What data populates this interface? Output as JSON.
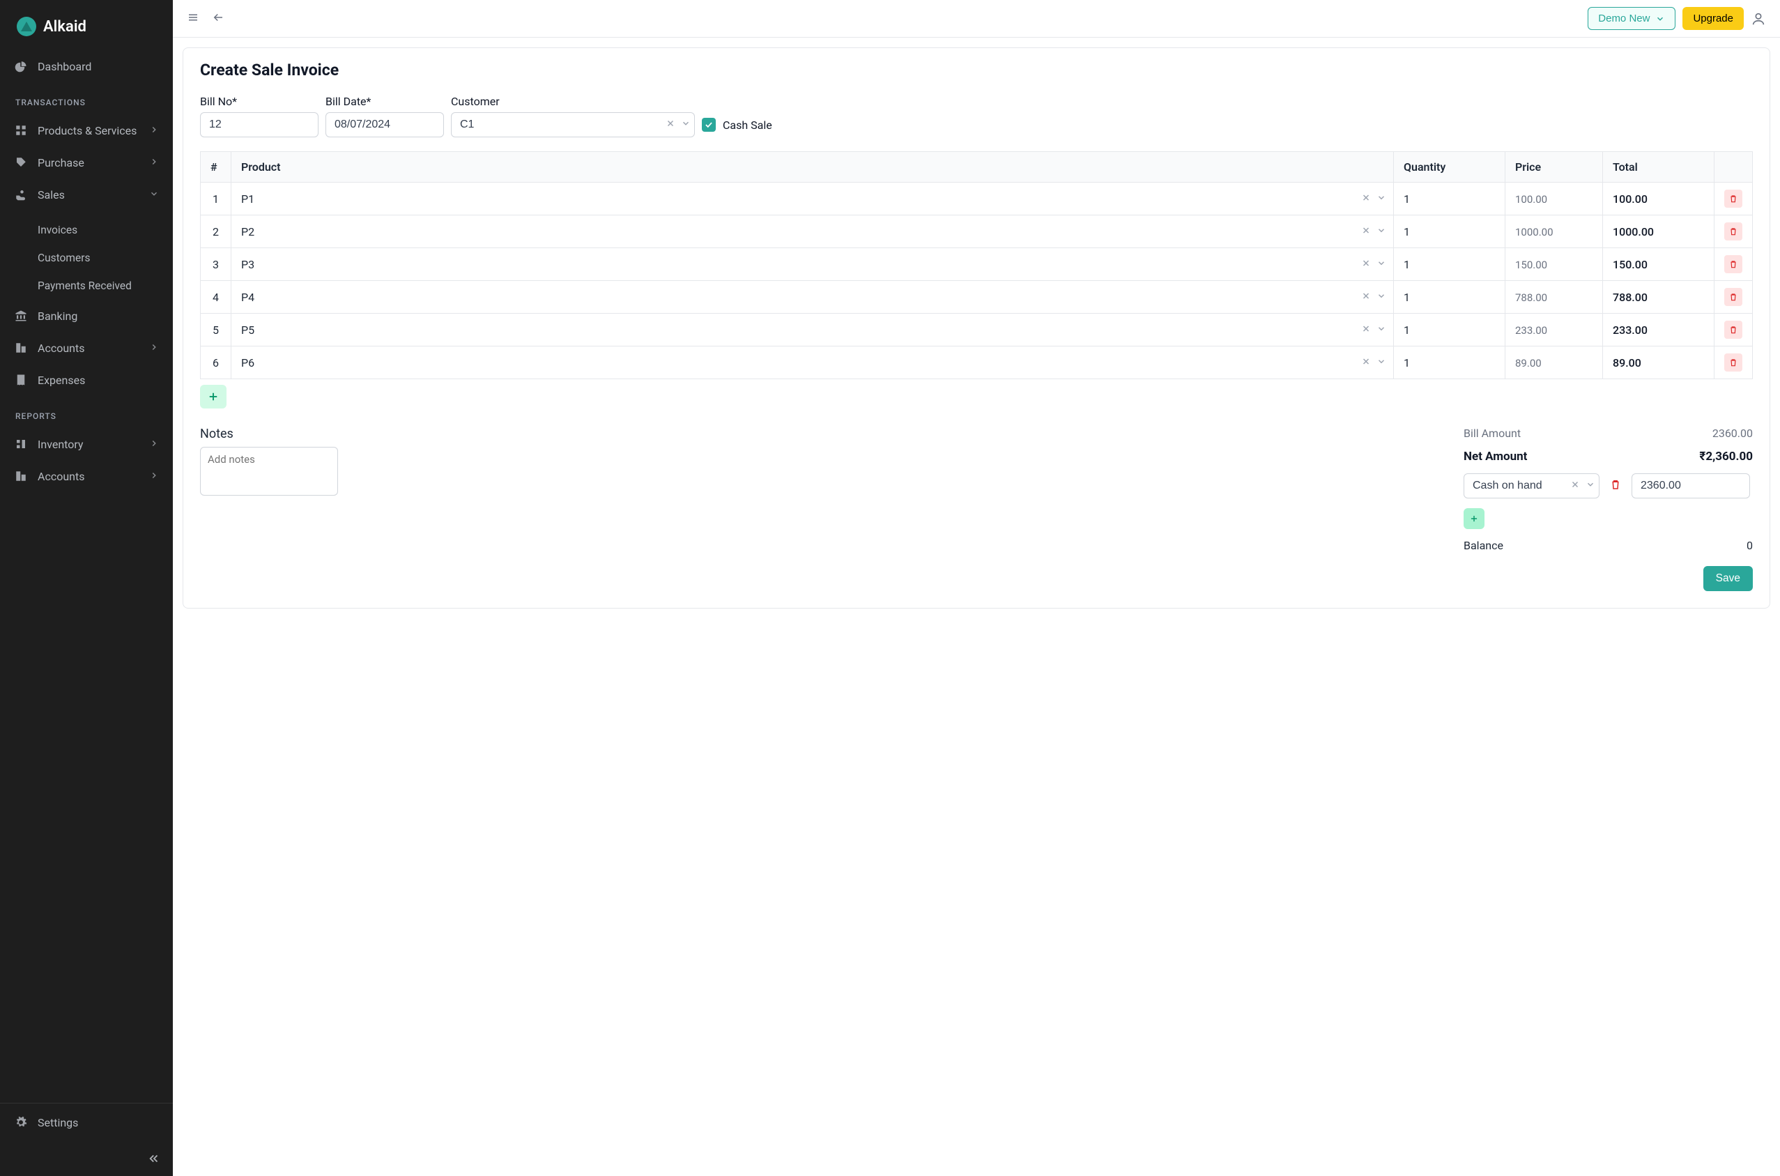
{
  "brand": {
    "name": "Alkaid"
  },
  "sidebar": {
    "dashboard": "Dashboard",
    "sections": {
      "transactions": "TRANSACTIONS",
      "reports": "REPORTS"
    },
    "items": {
      "products": "Products & Services",
      "purchase": "Purchase",
      "sales": "Sales",
      "banking": "Banking",
      "accounts1": "Accounts",
      "expenses": "Expenses",
      "inventory": "Inventory",
      "accounts2": "Accounts",
      "settings": "Settings"
    },
    "sales_sub": {
      "invoices": "Invoices",
      "customers": "Customers",
      "payments": "Payments Received"
    }
  },
  "topbar": {
    "demo": "Demo New",
    "upgrade": "Upgrade"
  },
  "page": {
    "title": "Create Sale Invoice",
    "labels": {
      "bill_no": "Bill No*",
      "bill_date": "Bill Date*",
      "customer": "Customer",
      "cash_sale": "Cash Sale",
      "notes": "Notes",
      "bill_amount": "Bill Amount",
      "net_amount": "Net Amount",
      "balance": "Balance",
      "save": "Save"
    },
    "fields": {
      "bill_no": "12",
      "bill_date": "08/07/2024",
      "customer": "C1",
      "cash_sale_checked": true,
      "notes_placeholder": "Add notes"
    }
  },
  "table": {
    "headers": {
      "idx": "#",
      "product": "Product",
      "qty": "Quantity",
      "price": "Price",
      "total": "Total"
    },
    "rows": [
      {
        "idx": "1",
        "product": "P1",
        "qty": "1",
        "price": "100.00",
        "total": "100.00"
      },
      {
        "idx": "2",
        "product": "P2",
        "qty": "1",
        "price": "1000.00",
        "total": "1000.00"
      },
      {
        "idx": "3",
        "product": "P3",
        "qty": "1",
        "price": "150.00",
        "total": "150.00"
      },
      {
        "idx": "4",
        "product": "P4",
        "qty": "1",
        "price": "788.00",
        "total": "788.00"
      },
      {
        "idx": "5",
        "product": "P5",
        "qty": "1",
        "price": "233.00",
        "total": "233.00"
      },
      {
        "idx": "6",
        "product": "P6",
        "qty": "1",
        "price": "89.00",
        "total": "89.00"
      }
    ]
  },
  "totals": {
    "bill_amount": "2360.00",
    "net_amount": "₹2,360.00",
    "balance": "0",
    "payment_method": "Cash on hand",
    "payment_amount": "2360.00"
  }
}
